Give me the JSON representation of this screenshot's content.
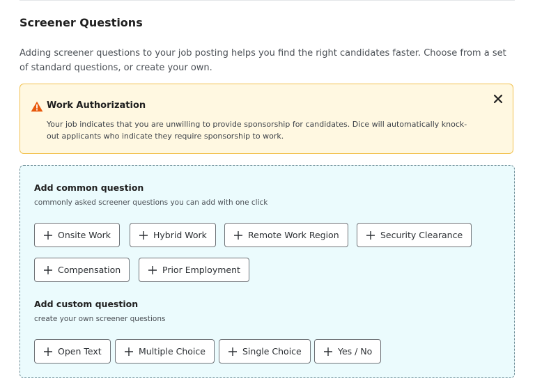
{
  "section": {
    "title": "Screener Questions",
    "description": "Adding screener questions to your job posting helps you find the right candidates faster. Choose from a set of standard questions, or create your own."
  },
  "alert": {
    "icon": "warning-icon",
    "title": "Work Authorization",
    "body": "Your job indicates that you are unwilling to provide sponsorship for candidates. Dice will automatically knock-out applicants who indicate they require sponsorship to work.",
    "close_icon": "close-icon",
    "colors": {
      "background": "#fff8e1",
      "border": "#f2c14e",
      "icon": "#e8590c"
    }
  },
  "common": {
    "title": "Add common question",
    "subtitle": "commonly asked screener questions you can add with one click",
    "buttons": [
      {
        "label": "Onsite Work"
      },
      {
        "label": "Hybrid Work"
      },
      {
        "label": "Remote Work Region"
      },
      {
        "label": "Security Clearance"
      },
      {
        "label": "Compensation"
      },
      {
        "label": "Prior Employment"
      }
    ]
  },
  "custom": {
    "title": "Add custom question",
    "subtitle": "create your own screener questions",
    "buttons": [
      {
        "label": "Open Text"
      },
      {
        "label": "Multiple Choice"
      },
      {
        "label": "Single Choice"
      },
      {
        "label": "Yes / No"
      }
    ]
  },
  "colors": {
    "questions_background": "#ebfbfd",
    "questions_border": "#6b8b95"
  }
}
